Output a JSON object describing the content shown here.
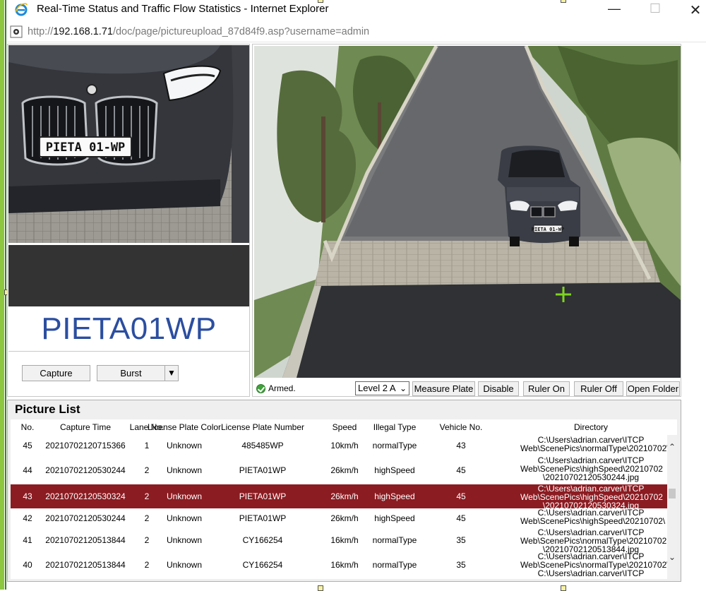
{
  "window": {
    "title": "Real-Time Status and Traffic Flow Statistics - Internet Explorer",
    "minimize_glyph": "—",
    "maximize_glyph": "☐",
    "close_glyph": "✕"
  },
  "address": {
    "prefix": "http://",
    "host": "192.168.1.71",
    "path": "/doc/page/pictureupload_87d84f9.asp?username=admin"
  },
  "left_panel": {
    "plate_image_text": "PIETA 01-WP",
    "plate_number": "PIETA01WP",
    "capture_label": "Capture",
    "burst_label": "Burst",
    "burst_dropdown_glyph": "▼"
  },
  "scene": {
    "scene_plate_text": "PIETA 01-WP",
    "armed_label": "Armed.",
    "level_value": "Level 2 A",
    "level_arrow": "⌄",
    "measure_plate_label": "Measure Plate",
    "disable_label": "Disable",
    "ruler_on_label": "Ruler On",
    "ruler_off_label": "Ruler Off",
    "open_folder_label": "Open Folder"
  },
  "picture_list": {
    "title": "Picture List",
    "columns": [
      "No.",
      "Capture Time",
      "Lane No.",
      "License Plate Color",
      "License Plate Number",
      "Speed",
      "Illegal Type",
      "Vehicle No.",
      "Directory"
    ],
    "rows": [
      {
        "no": "45",
        "time": "20210702120715366",
        "lane": "1",
        "color": "Unknown",
        "plate": "485485WP",
        "speed": "10km/h",
        "type": "normalType",
        "vehicle": "43",
        "dir": [
          "C:\\Users\\adrian.carver\\ITCP",
          "Web\\ScenePics\\normalType\\20210702\\"
        ],
        "selected": false
      },
      {
        "no": "44",
        "time": "20210702120530244",
        "lane": "2",
        "color": "Unknown",
        "plate": "PIETA01WP",
        "speed": "26km/h",
        "type": "highSpeed",
        "vehicle": "45",
        "dir": [
          "C:\\Users\\adrian.carver\\ITCP",
          "Web\\ScenePics\\highSpeed\\20210702",
          "\\20210702120530244.jpg"
        ],
        "selected": false
      },
      {
        "no": "43",
        "time": "20210702120530324",
        "lane": "2",
        "color": "Unknown",
        "plate": "PIETA01WP",
        "speed": "26km/h",
        "type": "highSpeed",
        "vehicle": "45",
        "dir": [
          "C:\\Users\\adrian.carver\\ITCP",
          "Web\\ScenePics\\highSpeed\\20210702",
          "\\20210702120530324.jpg"
        ],
        "selected": true
      },
      {
        "no": "42",
        "time": "20210702120530244",
        "lane": "2",
        "color": "Unknown",
        "plate": "PIETA01WP",
        "speed": "26km/h",
        "type": "highSpeed",
        "vehicle": "45",
        "dir": [
          "C:\\Users\\adrian.carver\\ITCP",
          "Web\\ScenePics\\highSpeed\\20210702\\"
        ],
        "selected": false
      },
      {
        "no": "41",
        "time": "20210702120513844",
        "lane": "2",
        "color": "Unknown",
        "plate": "CY166254",
        "speed": "16km/h",
        "type": "normalType",
        "vehicle": "35",
        "dir": [
          "C:\\Users\\adrian.carver\\ITCP",
          "Web\\ScenePics\\normalType\\20210702",
          "\\20210702120513844.jpg"
        ],
        "selected": false
      },
      {
        "no": "40",
        "time": "20210702120513844",
        "lane": "2",
        "color": "Unknown",
        "plate": "CY166254",
        "speed": "16km/h",
        "type": "normalType",
        "vehicle": "35",
        "dir": [
          "C:\\Users\\adrian.carver\\ITCP",
          "Web\\ScenePics\\normalType\\20210702\\",
          "C:\\Users\\adrian.carver\\ITCP"
        ],
        "selected": false
      }
    ],
    "scroll_up_glyph": "⌃",
    "scroll_down_glyph": "⌄"
  },
  "colors": {
    "selected_row": "#8b1c22",
    "plate_text": "#2b4ea0",
    "armed_green": "#3fa23a",
    "crosshair": "#7ed321"
  }
}
